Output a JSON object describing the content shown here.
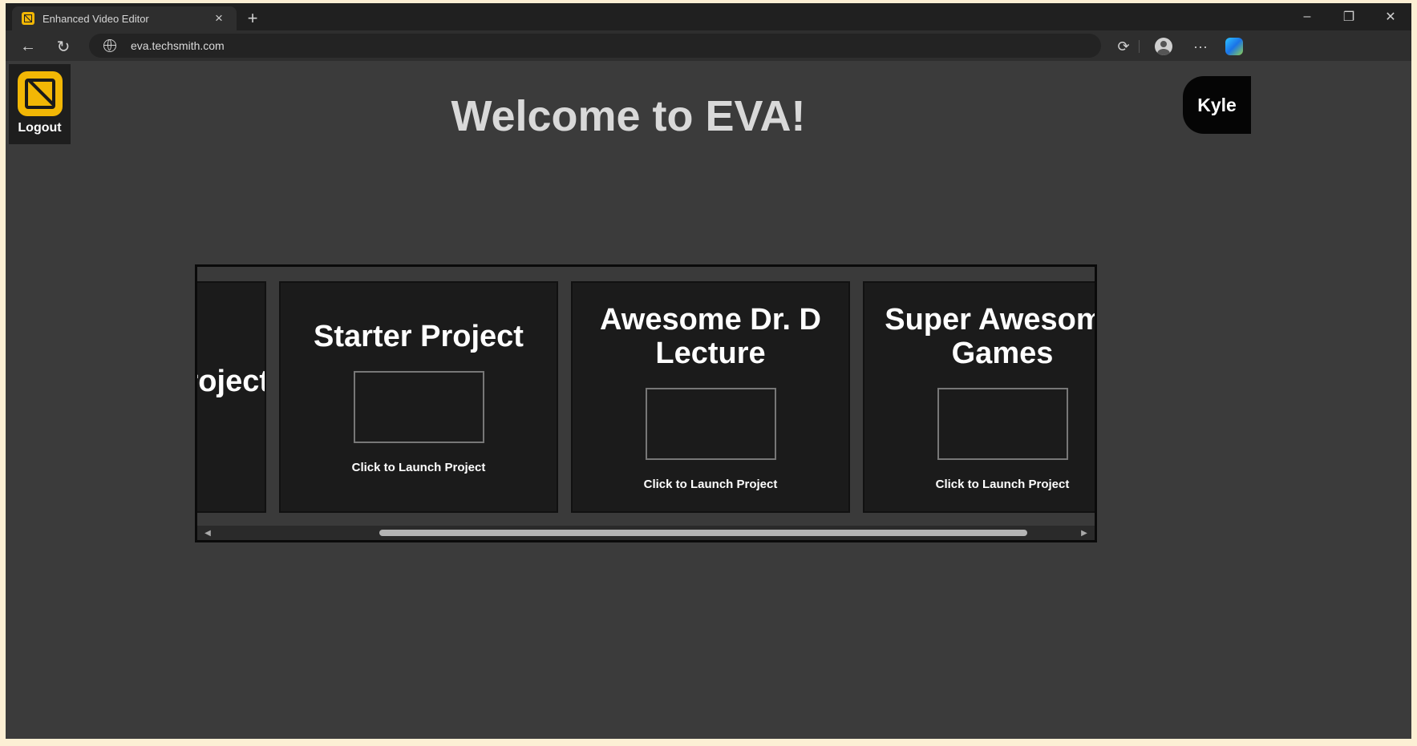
{
  "browser": {
    "tab_title": "Enhanced Video Editor",
    "tab_close": "×",
    "new_tab": "+",
    "url": "eva.techsmith.com",
    "window": {
      "minimize": "–",
      "restore": "❐",
      "close": "✕"
    },
    "menu_dots": "···"
  },
  "app": {
    "logout_label": "Logout",
    "title": "Welcome to EVA!",
    "user_name": "Kyle"
  },
  "projects": {
    "partial_card_title": "Project",
    "cards": [
      {
        "title_lines": [
          "Starter Project"
        ],
        "launch_label": "Click to Launch Project"
      },
      {
        "title_lines": [
          "Awesome Dr. D",
          "Lecture"
        ],
        "launch_label": "Click to Launch Project"
      },
      {
        "title_lines": [
          "Super Awesome",
          "Games"
        ],
        "launch_label": "Click to Launch Project"
      }
    ]
  },
  "colors": {
    "accent": "#f2b705",
    "page_bg": "#3b3b3b",
    "card_bg": "#1b1b1b"
  }
}
